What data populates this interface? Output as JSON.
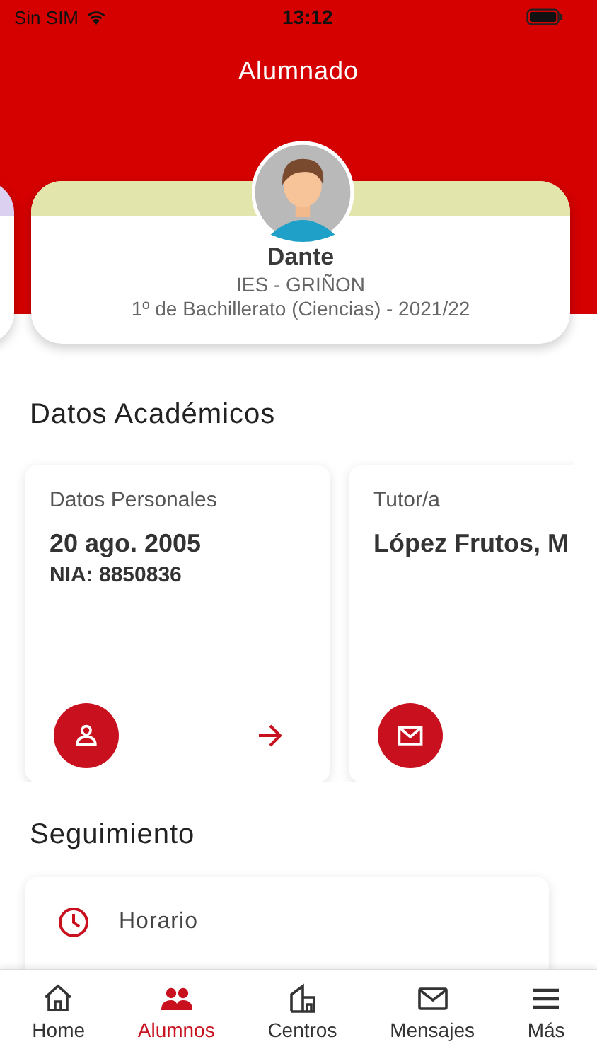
{
  "status_bar": {
    "carrier": "Sin SIM",
    "time": "13:12"
  },
  "header": {
    "title": "Alumnado"
  },
  "student": {
    "name": "Dante",
    "school": "IES - GRIÑON",
    "course": "1º de Bachillerato (Ciencias) - 2021/22"
  },
  "academic": {
    "title": "Datos Académicos",
    "cards": [
      {
        "kind": "personal",
        "label": "Datos Personales",
        "value": "20 ago. 2005",
        "detail": "NIA: 8850836"
      },
      {
        "kind": "tutor",
        "label": "Tutor/a",
        "value": "López Frutos, M"
      }
    ]
  },
  "tracking": {
    "title": "Seguimiento",
    "items": [
      {
        "label": "Horario"
      }
    ]
  },
  "tab_bar": [
    {
      "kind": "home",
      "label": "Home",
      "selected": false
    },
    {
      "kind": "students",
      "label": "Alumnos",
      "selected": true
    },
    {
      "kind": "centers",
      "label": "Centros",
      "selected": false
    },
    {
      "kind": "messages",
      "label": "Mensajes",
      "selected": false
    },
    {
      "kind": "more",
      "label": "Más",
      "selected": false
    }
  ]
}
